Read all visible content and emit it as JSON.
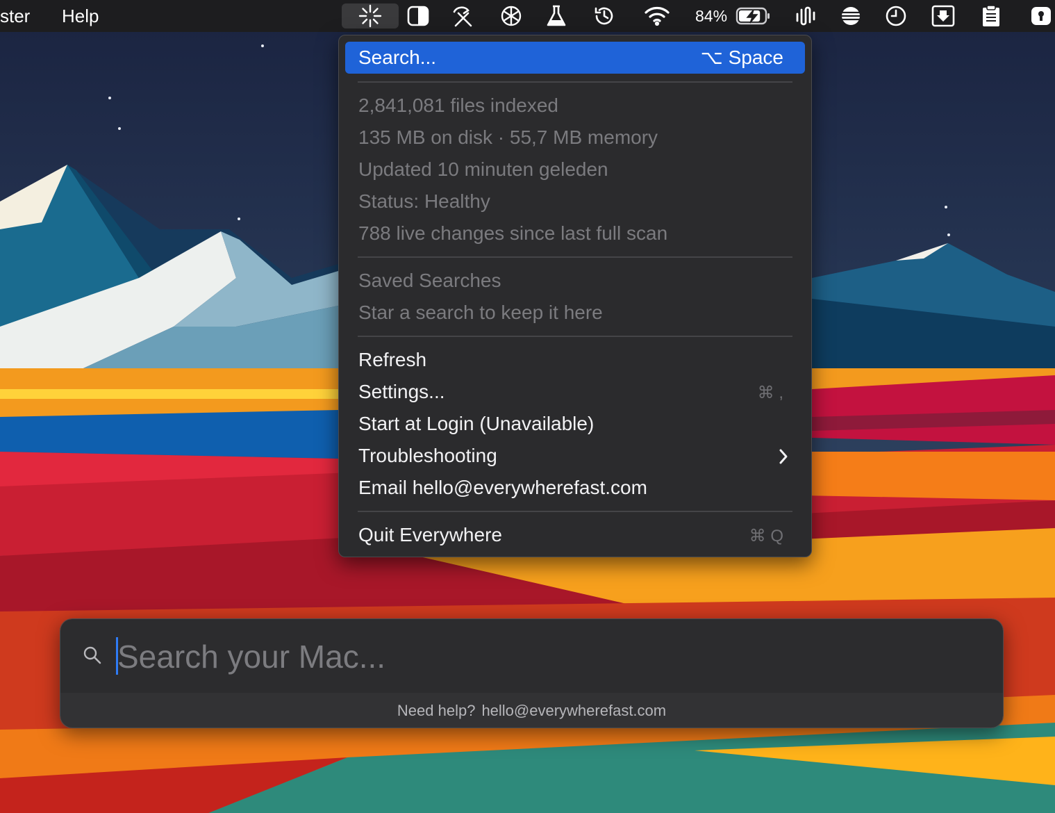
{
  "menubar": {
    "app_menus": [
      {
        "label": "ster"
      },
      {
        "label": "Help"
      }
    ],
    "tray_icons": [
      "everywhere-sparkle-icon",
      "half-circle-display-icon",
      "tools-icon",
      "openai-icon",
      "flask-icon",
      "time-machine-icon",
      "wifi-icon",
      "battery-charging-icon",
      "waveform-icon",
      "stack-icon",
      "clock-icon",
      "download-icon",
      "clipboard-icon",
      "password-icon"
    ],
    "battery_percent": "84%",
    "battery_level": 0.84
  },
  "menu": {
    "search": {
      "label": "Search...",
      "shortcut": "⌥ Space"
    },
    "status_lines": [
      "2,841,081 files indexed",
      "135 MB on disk · 55,7 MB memory",
      "Updated 10 minuten geleden",
      "Status: Healthy",
      "788 live changes since last full scan"
    ],
    "saved": {
      "heading": "Saved Searches",
      "empty_hint": "Star a search to keep it here"
    },
    "actions": {
      "refresh": "Refresh",
      "settings": "Settings...",
      "settings_shortcut": "⌘ ,",
      "login": "Start at Login (Unavailable)",
      "troubleshooting": "Troubleshooting",
      "email": "Email hello@everywherefast.com"
    },
    "quit": {
      "label": "Quit Everywhere",
      "shortcut": "⌘ Q"
    }
  },
  "search_panel": {
    "placeholder": "Search your Mac...",
    "help_prefix": "Need help?",
    "help_email": "hello@everywherefast.com"
  },
  "colors": {
    "highlight": "#1f63d8",
    "menu_bg": "#2b2b2d",
    "menubar_bg": "#1d1d1f",
    "caret": "#2f7cf6"
  }
}
